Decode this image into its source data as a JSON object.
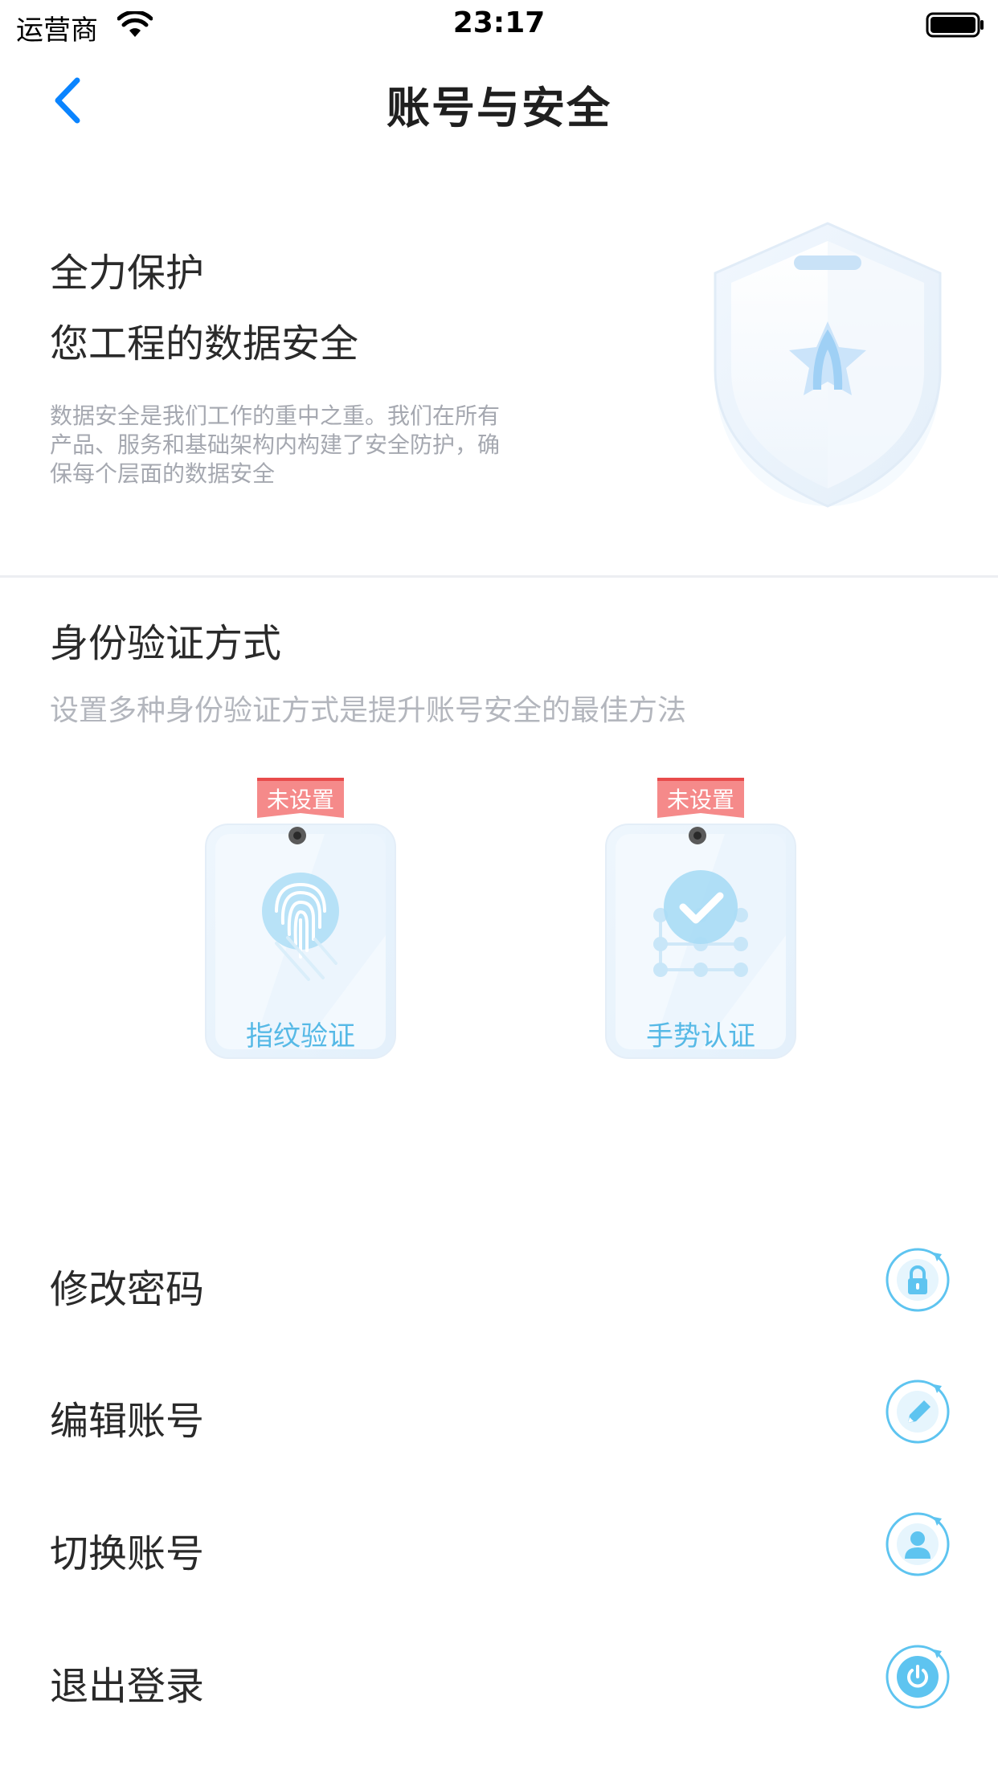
{
  "status_bar": {
    "carrier": "运营商",
    "time": "23:17"
  },
  "nav": {
    "title": "账号与安全",
    "back_icon": "chevron-left-icon"
  },
  "hero": {
    "line1": "全力保护",
    "line2": "您工程的数据安全",
    "description": "数据安全是我们工作的重中之重。我们在所有产品、服务和基础架构内构建了安全防护，确保每个层面的数据安全",
    "illustration_icon": "shield-icon"
  },
  "auth": {
    "title": "身份验证方式",
    "subtitle": "设置多种身份验证方式是提升账号安全的最佳方法",
    "methods": [
      {
        "label": "指纹验证",
        "badge": "未设置",
        "icon": "fingerprint-icon"
      },
      {
        "label": "手势认证",
        "badge": "未设置",
        "icon": "gesture-pattern-icon"
      }
    ]
  },
  "menu": [
    {
      "label": "修改密码",
      "icon": "lock-icon"
    },
    {
      "label": "编辑账号",
      "icon": "pencil-icon"
    },
    {
      "label": "切换账号",
      "icon": "user-icon"
    },
    {
      "label": "退出登录",
      "icon": "power-icon"
    }
  ],
  "colors": {
    "accent": "#0a84ff",
    "icon_blue": "#5ec4f0",
    "badge_red": "#f46a6a",
    "page_bg": "#f0f1f5"
  }
}
